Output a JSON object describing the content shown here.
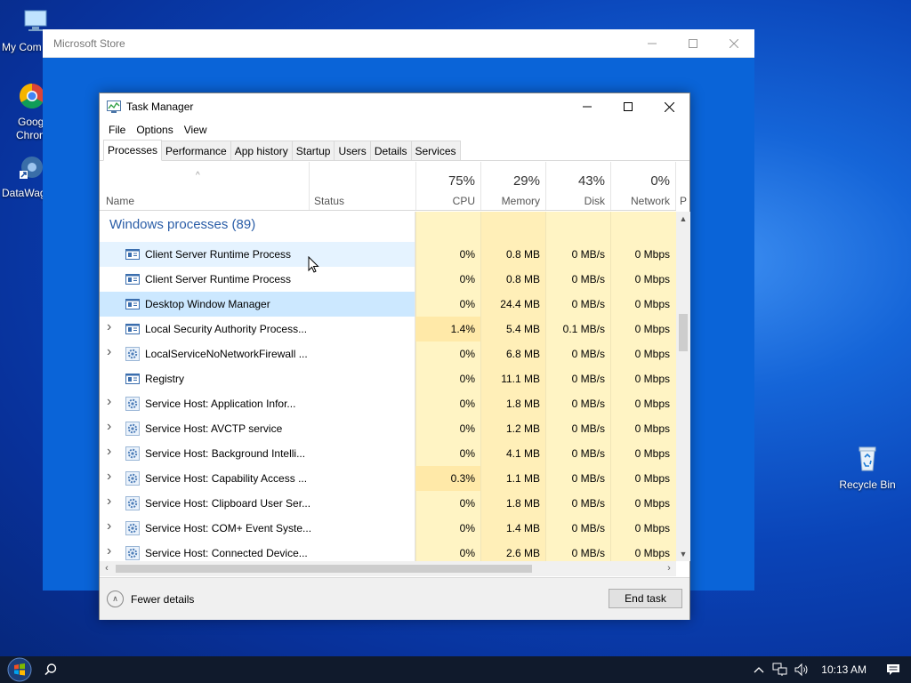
{
  "desktop": {
    "icons": [
      {
        "label_line1": "My Com",
        "label_line2": ""
      },
      {
        "label_line1": "Goog",
        "label_line2": "Chron"
      },
      {
        "label_line1": "DataWag",
        "label_line2": ""
      },
      {
        "label_line1": "Recycle Bin",
        "label_line2": ""
      }
    ]
  },
  "store_window": {
    "title": "Microsoft Store"
  },
  "task_manager": {
    "title": "Task Manager",
    "menu": [
      "File",
      "Options",
      "View"
    ],
    "tabs": [
      "Processes",
      "Performance",
      "App history",
      "Startup",
      "Users",
      "Details",
      "Services"
    ],
    "active_tab": "Processes",
    "columns": {
      "name": "Name",
      "status": "Status",
      "cpu": {
        "pct": "75%",
        "label": "CPU"
      },
      "memory": {
        "pct": "29%",
        "label": "Memory"
      },
      "disk": {
        "pct": "43%",
        "label": "Disk"
      },
      "network": {
        "pct": "0%",
        "label": "Network"
      },
      "power_partial": "P"
    },
    "group_label": "Windows processes (89)",
    "processes": [
      {
        "name": "Client Server Runtime Process",
        "cpu": "0%",
        "memory": "0.8 MB",
        "disk": "0 MB/s",
        "network": "0 Mbps",
        "expandable": false,
        "icon": "window-icon"
      },
      {
        "name": "Client Server Runtime Process",
        "cpu": "0%",
        "memory": "0.8 MB",
        "disk": "0 MB/s",
        "network": "0 Mbps",
        "expandable": false,
        "icon": "window-icon"
      },
      {
        "name": "Desktop Window Manager",
        "cpu": "0%",
        "memory": "24.4 MB",
        "disk": "0 MB/s",
        "network": "0 Mbps",
        "expandable": false,
        "icon": "window-icon"
      },
      {
        "name": "Local Security Authority Process...",
        "cpu": "1.4%",
        "memory": "5.4 MB",
        "disk": "0.1 MB/s",
        "network": "0 Mbps",
        "expandable": true,
        "icon": "window-icon"
      },
      {
        "name": "LocalServiceNoNetworkFirewall ...",
        "cpu": "0%",
        "memory": "6.8 MB",
        "disk": "0 MB/s",
        "network": "0 Mbps",
        "expandable": true,
        "icon": "gear-icon"
      },
      {
        "name": "Registry",
        "cpu": "0%",
        "memory": "11.1 MB",
        "disk": "0 MB/s",
        "network": "0 Mbps",
        "expandable": false,
        "icon": "window-icon"
      },
      {
        "name": "Service Host: Application Infor...",
        "cpu": "0%",
        "memory": "1.8 MB",
        "disk": "0 MB/s",
        "network": "0 Mbps",
        "expandable": true,
        "icon": "gear-icon"
      },
      {
        "name": "Service Host: AVCTP service",
        "cpu": "0%",
        "memory": "1.2 MB",
        "disk": "0 MB/s",
        "network": "0 Mbps",
        "expandable": true,
        "icon": "gear-icon"
      },
      {
        "name": "Service Host: Background Intelli...",
        "cpu": "0%",
        "memory": "4.1 MB",
        "disk": "0 MB/s",
        "network": "0 Mbps",
        "expandable": true,
        "icon": "gear-icon"
      },
      {
        "name": "Service Host: Capability Access ...",
        "cpu": "0.3%",
        "memory": "1.1 MB",
        "disk": "0 MB/s",
        "network": "0 Mbps",
        "expandable": true,
        "icon": "gear-icon"
      },
      {
        "name": "Service Host: Clipboard User Ser...",
        "cpu": "0%",
        "memory": "1.8 MB",
        "disk": "0 MB/s",
        "network": "0 Mbps",
        "expandable": true,
        "icon": "gear-icon"
      },
      {
        "name": "Service Host: COM+ Event Syste...",
        "cpu": "0%",
        "memory": "1.4 MB",
        "disk": "0 MB/s",
        "network": "0 Mbps",
        "expandable": true,
        "icon": "gear-icon"
      },
      {
        "name": "Service Host: Connected Device...",
        "cpu": "0%",
        "memory": "2.6 MB",
        "disk": "0 MB/s",
        "network": "0 Mbps",
        "expandable": true,
        "icon": "gear-icon"
      }
    ],
    "footer": {
      "fewer_details": "Fewer details",
      "end_task": "End task"
    }
  },
  "taskbar": {
    "clock": "10:13 AM"
  },
  "colors": {
    "cpu_heat_low": "#fff4c4",
    "cpu_heat_mid": "#ffe9a8",
    "mem_heat": "#ffe9a8",
    "group_text": "#2a5da7",
    "selected_row": "#cce8ff"
  }
}
